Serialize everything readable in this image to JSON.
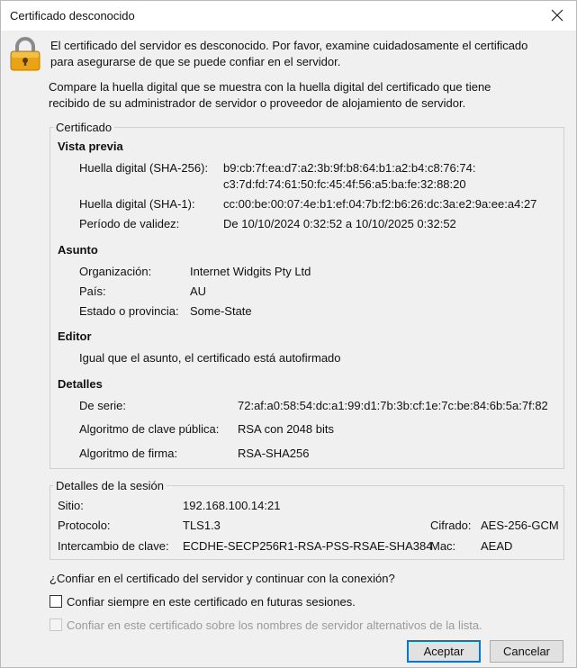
{
  "window": {
    "title": "Certificado desconocido"
  },
  "intro": {
    "line1": "El certificado del servidor es desconocido. Por favor, examine cuidadosamente el certificado para asegurarse de que se puede confiar en el servidor.",
    "line2": "Compare la huella digital que se muestra con la huella digital del certificado que tiene recibido de su administrador de servidor o proveedor de alojamiento de servidor."
  },
  "certificate": {
    "legend": "Certificado",
    "preview": {
      "heading": "Vista previa",
      "sha256_label": "Huella digital (SHA-256):",
      "sha256_value_line1": "b9:cb:7f:ea:d7:a2:3b:9f:b8:64:b1:a2:b4:c8:76:74:",
      "sha256_value_line2": "c3:7d:fd:74:61:50:fc:45:4f:56:a5:ba:fe:32:88:20",
      "sha1_label": "Huella digital (SHA-1):",
      "sha1_value": "cc:00:be:00:07:4e:b1:ef:04:7b:f2:b6:26:dc:3a:e2:9a:ee:a4:27",
      "validity_label": "Período de validez:",
      "validity_value": "De 10/10/2024 0:32:52 a 10/10/2025 0:32:52"
    },
    "subject": {
      "heading": "Asunto",
      "org_label": "Organización:",
      "org_value": "Internet Widgits Pty Ltd",
      "country_label": "País:",
      "country_value": "AU",
      "state_label": "Estado o provincia:",
      "state_value": "Some-State"
    },
    "issuer": {
      "heading": "Editor",
      "text": "Igual que el asunto, el certificado está autofirmado"
    },
    "details": {
      "heading": "Detalles",
      "serial_label": "De serie:",
      "serial_value": "72:af:a0:58:54:dc:a1:99:d1:7b:3b:cf:1e:7c:be:84:6b:5a:7f:82",
      "pubkey_label": "Algoritmo de clave pública:",
      "pubkey_value": "RSA con 2048 bits",
      "sig_label": "Algoritmo de firma:",
      "sig_value": "RSA-SHA256"
    }
  },
  "session": {
    "legend": "Detalles de la sesión",
    "site_label": "Sitio:",
    "site_value": "192.168.100.14:21",
    "protocol_label": "Protocolo:",
    "protocol_value": "TLS1.3",
    "cipher_label": "Cifrado:",
    "cipher_value": "AES-256-GCM",
    "kex_label": "Intercambio de clave:",
    "kex_value": "ECDHE-SECP256R1-RSA-PSS-RSAE-SHA384",
    "mac_label": "Mac:",
    "mac_value": "AEAD"
  },
  "question": "¿Confiar en el certificado del servidor y continuar con la conexión?",
  "options": {
    "always_trust": {
      "label": "Confiar siempre en este certificado en futuras sesiones.",
      "checked": false
    },
    "alt_names": {
      "label": "Confiar en este certificado sobre los nombres de servidor alternativos de la lista.",
      "checked": false,
      "disabled": true
    }
  },
  "buttons": {
    "accept": "Aceptar",
    "cancel": "Cancelar"
  },
  "icons": {
    "lock": "padlock-icon",
    "close": "close-icon"
  },
  "colors": {
    "lock_gold": "#e8a317",
    "lock_shackle": "#8a8a8a",
    "default_button_border": "#0078d7"
  }
}
